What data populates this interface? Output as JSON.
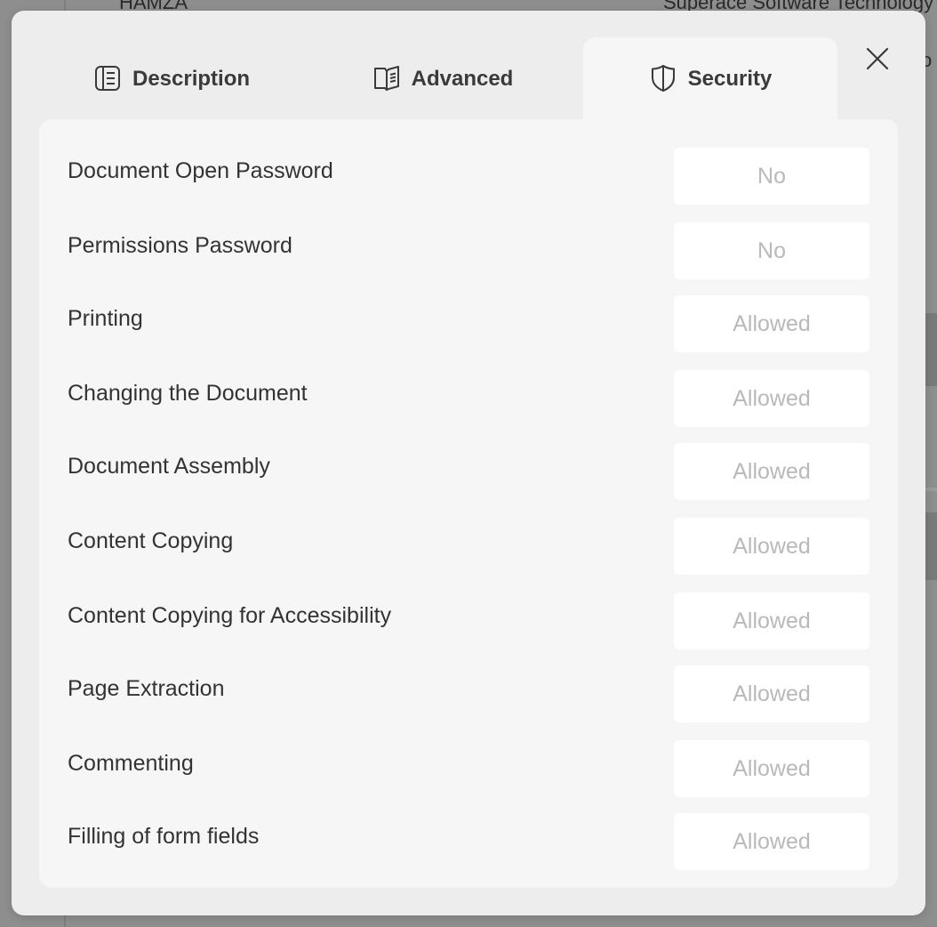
{
  "background": {
    "author_text": "HAMZA",
    "producer_text": "Superace Software Technology",
    "trailing_text": "o"
  },
  "tabs": [
    {
      "label": "Description",
      "icon": "description-icon"
    },
    {
      "label": "Advanced",
      "icon": "book-icon"
    },
    {
      "label": "Security",
      "icon": "shield-icon",
      "selected": true
    }
  ],
  "close_icon": "close-icon",
  "security": {
    "rows": [
      {
        "label": "Document Open Password",
        "value": "No"
      },
      {
        "label": "Permissions Password",
        "value": "No"
      },
      {
        "label": "Printing",
        "value": "Allowed"
      },
      {
        "label": "Changing the Document",
        "value": "Allowed"
      },
      {
        "label": "Document Assembly",
        "value": "Allowed"
      },
      {
        "label": "Content Copying",
        "value": "Allowed"
      },
      {
        "label": "Content Copying for Accessibility",
        "value": "Allowed"
      },
      {
        "label": "Page Extraction",
        "value": "Allowed"
      },
      {
        "label": "Commenting",
        "value": "Allowed"
      },
      {
        "label": "Filling of form fields",
        "value": "Allowed"
      }
    ]
  },
  "colors": {
    "overlay_background": "#8e8e8e",
    "dialog_background": "#ededed",
    "panel_background": "#f6f6f6",
    "value_text": "#b9b9b9"
  }
}
